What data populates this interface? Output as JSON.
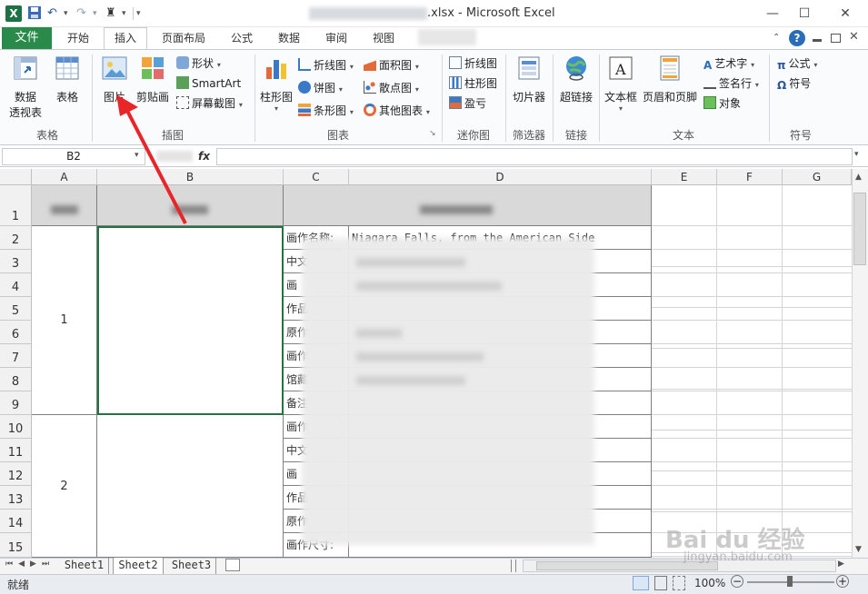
{
  "window": {
    "title_suffix": ".xlsx - Microsoft Excel",
    "minimize": "—",
    "maximize": "☐",
    "close": "✕"
  },
  "quick_access": {
    "excel_icon": "X",
    "undo": "↶",
    "redo": "↷",
    "binoculars": "♜"
  },
  "tabs": {
    "file": "文件",
    "items": [
      "开始",
      "插入",
      "页面布局",
      "公式",
      "数据",
      "审阅",
      "视图"
    ]
  },
  "ribbon": {
    "pivot_label_1": "数据",
    "pivot_label_2": "透视表",
    "table_label": "表格",
    "tables_group": "表格",
    "picture_label": "图片",
    "clipart_label": "剪贴画",
    "shapes": "形状",
    "smartart": "SmartArt",
    "screenshot": "屏幕截图",
    "illustrations_group": "插图",
    "column_chart": "柱形图",
    "line_chart": "折线图",
    "pie_chart": "饼图",
    "bar_chart": "条形图",
    "area_chart": "面积图",
    "scatter_chart": "散点图",
    "other_charts": "其他图表",
    "charts_group": "图表",
    "spark_line": "折线图",
    "spark_column": "柱形图",
    "spark_winloss": "盈亏",
    "sparklines_group": "迷你图",
    "slicer": "切片器",
    "filter_group": "筛选器",
    "hyperlink": "超链接",
    "links_group": "链接",
    "textbox": "文本框",
    "header_footer": "页眉和页脚",
    "wordart": "艺术字",
    "signature": "签名行",
    "object": "对象",
    "text_group": "文本",
    "equation": "公式",
    "symbol": "符号",
    "symbols_group": "符号"
  },
  "formula_bar": {
    "name_box": "B2",
    "fx": "fx",
    "content": ""
  },
  "columns": [
    "A",
    "B",
    "C",
    "D",
    "E",
    "F",
    "G"
  ],
  "rows": [
    "1",
    "2",
    "3",
    "4",
    "5",
    "6",
    "7",
    "8",
    "9",
    "10",
    "11",
    "12",
    "13",
    "14",
    "15"
  ],
  "cells": {
    "a_group_1": "1",
    "a_group_2": "2",
    "c_labels": [
      "画作名称:",
      "中文",
      "画",
      "作品",
      "原作",
      "画作",
      "馆藏",
      "备注",
      "画作",
      "中文",
      "画",
      "作品",
      "原作",
      "画作尺寸:"
    ],
    "d2": "Niagara Falls, from the American Side"
  },
  "sheets": [
    "Sheet1",
    "Sheet2",
    "Sheet3"
  ],
  "status": {
    "ready": "就绪",
    "zoom": "100%",
    "minus": "−",
    "plus": "+"
  },
  "watermark": {
    "text": "Bai du 经验",
    "sub": "jingyan.baidu.com"
  }
}
